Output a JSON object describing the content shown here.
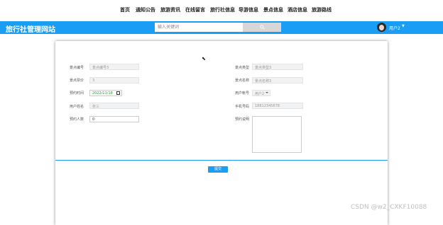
{
  "nav": {
    "items": [
      "首页",
      "通知公告",
      "旅游资讯",
      "在线留言",
      "旅行社信息",
      "导游信息",
      "景点信息",
      "酒店信息",
      "旅游路线"
    ]
  },
  "header": {
    "title": "旅行社管理网站",
    "search_placeholder": "输入关键词",
    "user": "用户2",
    "colors": {
      "header": "#1a9ef5",
      "accent": "#1a9ef5"
    }
  },
  "form": {
    "labels": {
      "spot_code": "景点编号",
      "spot_type": "景点类型",
      "spot_name": "景点名称",
      "spot_price": "景点票价",
      "book_time": "预约时间",
      "user_account": "用户帐号",
      "user_name": "用户姓名",
      "phone": "手机号码",
      "headcount": "预约人数",
      "remark": "预约说明"
    },
    "values": {
      "spot_code": "景点编号3",
      "spot_type": "景点类型3",
      "spot_name": "景点名称3",
      "spot_price": "3",
      "book_time": "2022/11/18",
      "user_account": "用户2",
      "user_name": "张三",
      "phone": "18812345678",
      "headcount": "0",
      "remark": ""
    },
    "submit": "提交"
  },
  "watermark": "CSDN @w2_CXKF10088"
}
